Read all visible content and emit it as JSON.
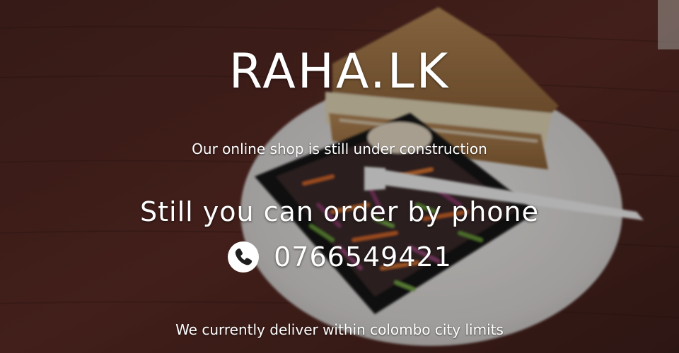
{
  "hero": {
    "brand": "RAHA.LK",
    "tagline": "Our online shop is still under construction",
    "order_heading": "Still you can order by phone",
    "phone_number": "0766549421",
    "delivery_note": "We currently deliver within colombo city limits",
    "phone_icon": "phone-icon"
  },
  "colors": {
    "text": "#ffffff",
    "table_wood": "#5a2a22",
    "plate": "#e8e6e4"
  }
}
